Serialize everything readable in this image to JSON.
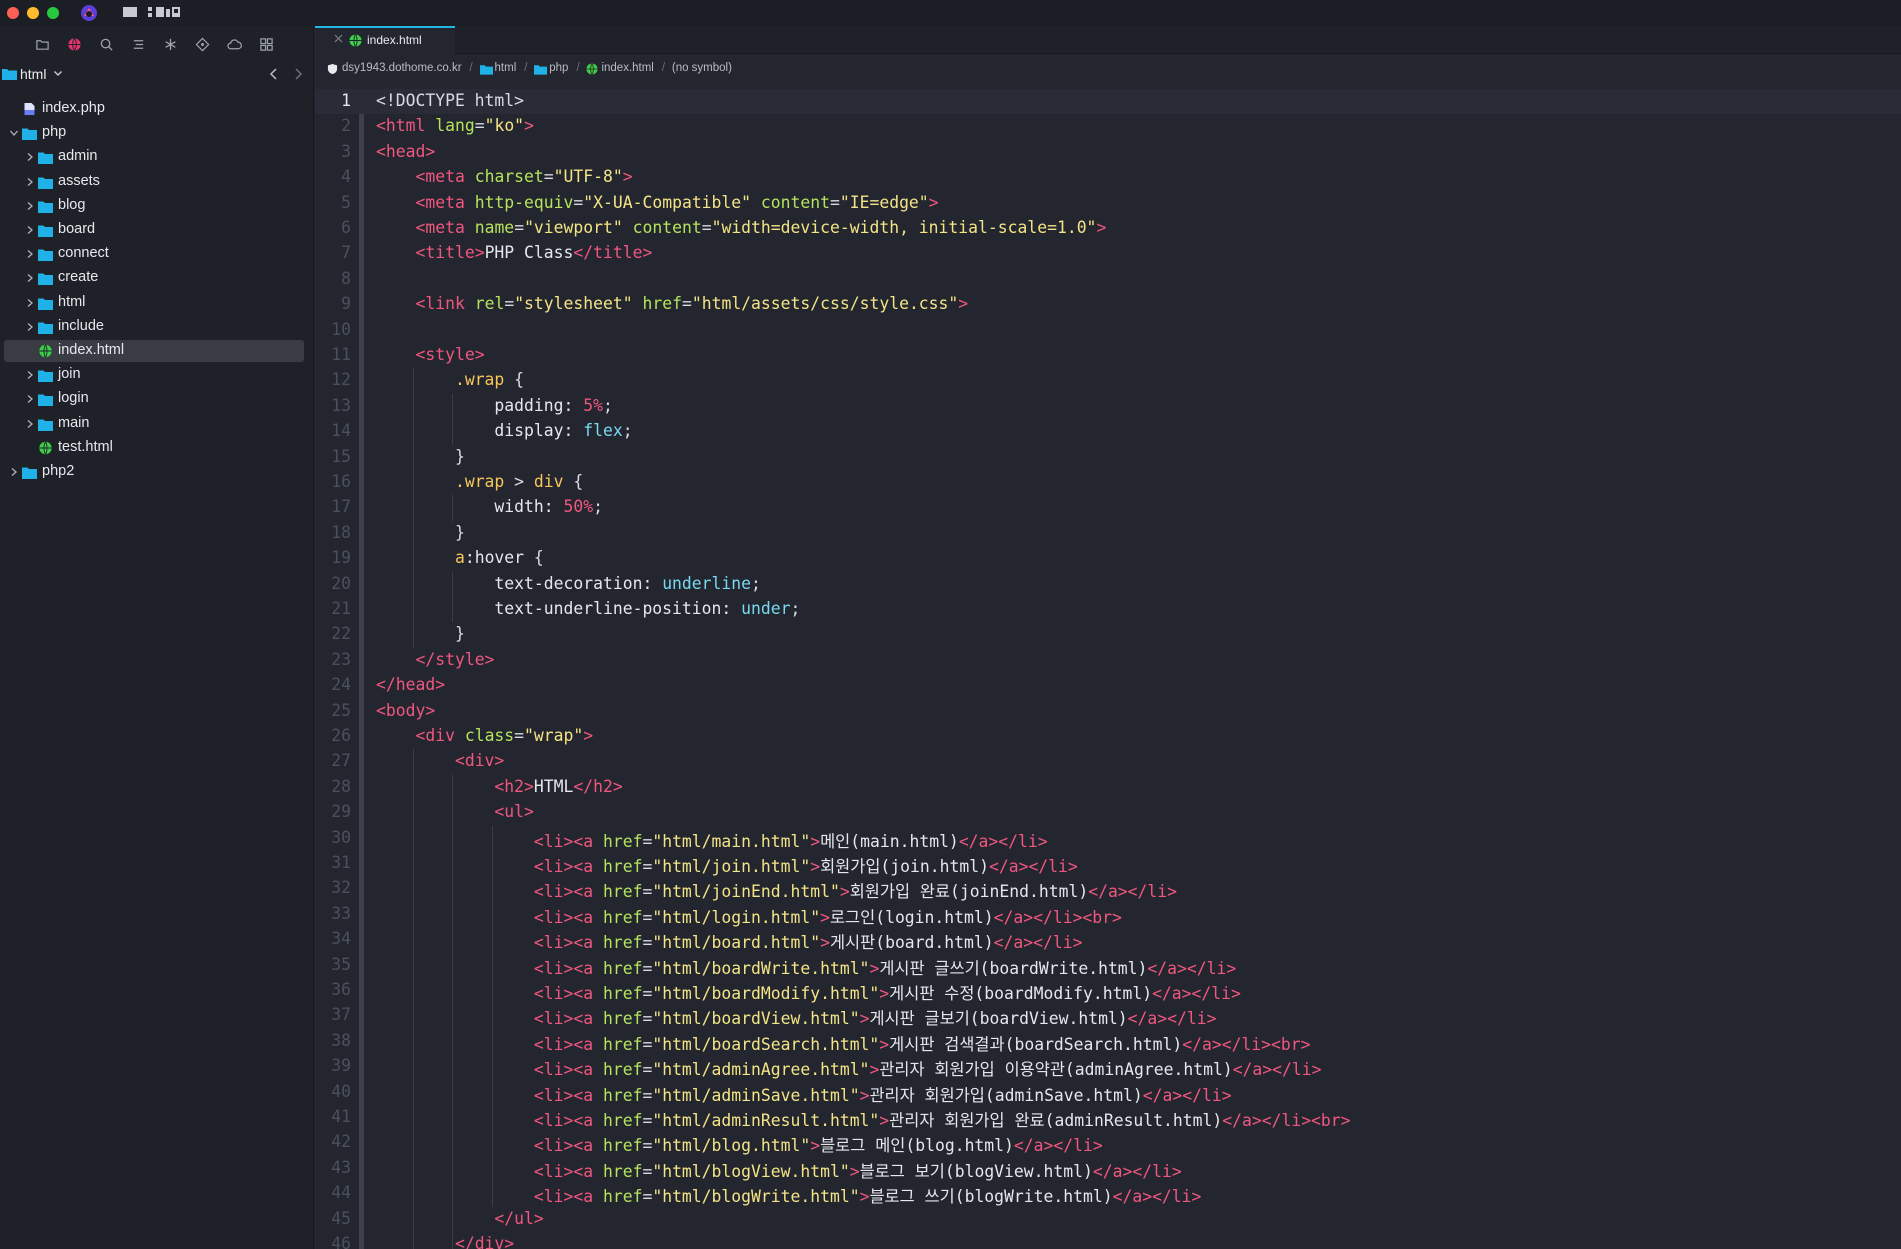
{
  "window": {
    "title_hidden": true
  },
  "colors": {
    "accent": "#21b6e4",
    "folder": "#1fb1e8",
    "html_file": "#3ecf4a",
    "php_file": "#6b7cf5",
    "tag": "#f0577e",
    "attr": "#b5e35d",
    "string": "#f3e486"
  },
  "sidebar": {
    "toolbar_icons": [
      "folder-icon",
      "globe-icon",
      "search-icon",
      "symbols-icon",
      "asterisk-icon",
      "git-icon",
      "cloud-icon",
      "grid-icon"
    ],
    "scope_label": "html",
    "tree": [
      {
        "label": "index.php",
        "type": "php",
        "depth": 0,
        "chevron": "none"
      },
      {
        "label": "php",
        "type": "folder",
        "depth": 0,
        "chevron": "open"
      },
      {
        "label": "admin",
        "type": "folder",
        "depth": 1,
        "chevron": "closed"
      },
      {
        "label": "assets",
        "type": "folder",
        "depth": 1,
        "chevron": "closed"
      },
      {
        "label": "blog",
        "type": "folder",
        "depth": 1,
        "chevron": "closed"
      },
      {
        "label": "board",
        "type": "folder",
        "depth": 1,
        "chevron": "closed"
      },
      {
        "label": "connect",
        "type": "folder",
        "depth": 1,
        "chevron": "closed"
      },
      {
        "label": "create",
        "type": "folder",
        "depth": 1,
        "chevron": "closed"
      },
      {
        "label": "html",
        "type": "folder",
        "depth": 1,
        "chevron": "closed"
      },
      {
        "label": "include",
        "type": "folder",
        "depth": 1,
        "chevron": "closed"
      },
      {
        "label": "index.html",
        "type": "html",
        "depth": 1,
        "chevron": "none",
        "selected": true
      },
      {
        "label": "join",
        "type": "folder",
        "depth": 1,
        "chevron": "closed"
      },
      {
        "label": "login",
        "type": "folder",
        "depth": 1,
        "chevron": "closed"
      },
      {
        "label": "main",
        "type": "folder",
        "depth": 1,
        "chevron": "closed"
      },
      {
        "label": "test.html",
        "type": "html",
        "depth": 1,
        "chevron": "none"
      },
      {
        "label": "php2",
        "type": "folder",
        "depth": 0,
        "chevron": "closed"
      }
    ]
  },
  "editor": {
    "tab": {
      "label": "index.html"
    },
    "breadcrumb": [
      {
        "label": "dsy1943.dothome.co.kr",
        "icon": "shield"
      },
      {
        "label": "html",
        "icon": "folder"
      },
      {
        "label": "php",
        "icon": "folder"
      },
      {
        "label": "index.html",
        "icon": "html"
      },
      {
        "label": "(no symbol)",
        "icon": "none"
      }
    ],
    "current_line": 1,
    "lines": [
      [
        [
          "t-punct",
          "<!DOCTYPE html>"
        ]
      ],
      [
        [
          "t-tag",
          "<html "
        ],
        [
          "t-attr",
          "lang"
        ],
        [
          "t-punct",
          "="
        ],
        [
          "t-str",
          "\"ko\""
        ],
        [
          "t-tag",
          ">"
        ]
      ],
      [
        [
          "t-tag",
          "<head>"
        ]
      ],
      [
        [
          "t-punct",
          "    "
        ],
        [
          "t-tag",
          "<meta "
        ],
        [
          "t-attr",
          "charset"
        ],
        [
          "t-punct",
          "="
        ],
        [
          "t-str",
          "\"UTF-8\""
        ],
        [
          "t-tag",
          ">"
        ]
      ],
      [
        [
          "t-punct",
          "    "
        ],
        [
          "t-tag",
          "<meta "
        ],
        [
          "t-attr",
          "http-equiv"
        ],
        [
          "t-punct",
          "="
        ],
        [
          "t-str",
          "\"X-UA-Compatible\""
        ],
        [
          "t-punct",
          " "
        ],
        [
          "t-attr",
          "content"
        ],
        [
          "t-punct",
          "="
        ],
        [
          "t-str",
          "\"IE=edge\""
        ],
        [
          "t-tag",
          ">"
        ]
      ],
      [
        [
          "t-punct",
          "    "
        ],
        [
          "t-tag",
          "<meta "
        ],
        [
          "t-attr",
          "name"
        ],
        [
          "t-punct",
          "="
        ],
        [
          "t-str",
          "\"viewport\""
        ],
        [
          "t-punct",
          " "
        ],
        [
          "t-attr",
          "content"
        ],
        [
          "t-punct",
          "="
        ],
        [
          "t-str",
          "\"width=device-width, initial-scale=1.0\""
        ],
        [
          "t-tag",
          ">"
        ]
      ],
      [
        [
          "t-punct",
          "    "
        ],
        [
          "t-tag",
          "<title>"
        ],
        [
          "t-txt",
          "PHP Class"
        ],
        [
          "t-tag",
          "</title>"
        ]
      ],
      [],
      [
        [
          "t-punct",
          "    "
        ],
        [
          "t-tag",
          "<link "
        ],
        [
          "t-attr",
          "rel"
        ],
        [
          "t-punct",
          "="
        ],
        [
          "t-str",
          "\"stylesheet\""
        ],
        [
          "t-punct",
          " "
        ],
        [
          "t-attr",
          "href"
        ],
        [
          "t-punct",
          "="
        ],
        [
          "t-str",
          "\"html/assets/css/style.css\""
        ],
        [
          "t-tag",
          ">"
        ]
      ],
      [],
      [
        [
          "t-punct",
          "    "
        ],
        [
          "t-tag",
          "<style>"
        ]
      ],
      [
        [
          "t-punct",
          "        "
        ],
        [
          "t-sel",
          ".wrap"
        ],
        [
          "t-punct",
          " {"
        ]
      ],
      [
        [
          "t-punct",
          "            "
        ],
        [
          "t-prop",
          "padding: "
        ],
        [
          "t-num",
          "5%"
        ],
        [
          "t-punct",
          ";"
        ]
      ],
      [
        [
          "t-punct",
          "            "
        ],
        [
          "t-prop",
          "display: "
        ],
        [
          "t-kw",
          "flex"
        ],
        [
          "t-punct",
          ";"
        ]
      ],
      [
        [
          "t-punct",
          "        }"
        ]
      ],
      [
        [
          "t-punct",
          "        "
        ],
        [
          "t-sel",
          ".wrap"
        ],
        [
          "t-punct",
          " > "
        ],
        [
          "t-sel",
          "div"
        ],
        [
          "t-punct",
          " {"
        ]
      ],
      [
        [
          "t-punct",
          "            "
        ],
        [
          "t-prop",
          "width: "
        ],
        [
          "t-num",
          "50%"
        ],
        [
          "t-punct",
          ";"
        ]
      ],
      [
        [
          "t-punct",
          "        }"
        ]
      ],
      [
        [
          "t-punct",
          "        "
        ],
        [
          "t-sel",
          "a"
        ],
        [
          "t-prop",
          ":hover"
        ],
        [
          "t-punct",
          " {"
        ]
      ],
      [
        [
          "t-punct",
          "            "
        ],
        [
          "t-prop",
          "text-decoration: "
        ],
        [
          "t-kw",
          "underline"
        ],
        [
          "t-punct",
          ";"
        ]
      ],
      [
        [
          "t-punct",
          "            "
        ],
        [
          "t-prop",
          "text-underline-position: "
        ],
        [
          "t-kw",
          "under"
        ],
        [
          "t-punct",
          ";"
        ]
      ],
      [
        [
          "t-punct",
          "        }"
        ]
      ],
      [
        [
          "t-punct",
          "    "
        ],
        [
          "t-tag",
          "</style>"
        ]
      ],
      [
        [
          "t-tag",
          "</head>"
        ]
      ],
      [
        [
          "t-tag",
          "<body>"
        ]
      ],
      [
        [
          "t-punct",
          "    "
        ],
        [
          "t-tag",
          "<div "
        ],
        [
          "t-attr",
          "class"
        ],
        [
          "t-punct",
          "="
        ],
        [
          "t-str",
          "\"wrap\""
        ],
        [
          "t-tag",
          ">"
        ]
      ],
      [
        [
          "t-punct",
          "        "
        ],
        [
          "t-tag",
          "<div>"
        ]
      ],
      [
        [
          "t-punct",
          "            "
        ],
        [
          "t-tag",
          "<h2>"
        ],
        [
          "t-txt",
          "HTML"
        ],
        [
          "t-tag",
          "</h2>"
        ]
      ],
      [
        [
          "t-punct",
          "            "
        ],
        [
          "t-tag",
          "<ul>"
        ]
      ],
      [
        [
          "t-punct",
          "                "
        ],
        [
          "t-tag",
          "<li><a "
        ],
        [
          "t-attr",
          "href"
        ],
        [
          "t-punct",
          "="
        ],
        [
          "t-str",
          "\"html/main.html\""
        ],
        [
          "t-tag",
          ">"
        ],
        [
          "t-txt",
          "메인(main.html)"
        ],
        [
          "t-tag",
          "</a></li>"
        ]
      ],
      [
        [
          "t-punct",
          "                "
        ],
        [
          "t-tag",
          "<li><a "
        ],
        [
          "t-attr",
          "href"
        ],
        [
          "t-punct",
          "="
        ],
        [
          "t-str",
          "\"html/join.html\""
        ],
        [
          "t-tag",
          ">"
        ],
        [
          "t-txt",
          "회원가입(join.html)"
        ],
        [
          "t-tag",
          "</a></li>"
        ]
      ],
      [
        [
          "t-punct",
          "                "
        ],
        [
          "t-tag",
          "<li><a "
        ],
        [
          "t-attr",
          "href"
        ],
        [
          "t-punct",
          "="
        ],
        [
          "t-str",
          "\"html/joinEnd.html\""
        ],
        [
          "t-tag",
          ">"
        ],
        [
          "t-txt",
          "회원가입 완료(joinEnd.html)"
        ],
        [
          "t-tag",
          "</a></li>"
        ]
      ],
      [
        [
          "t-punct",
          "                "
        ],
        [
          "t-tag",
          "<li><a "
        ],
        [
          "t-attr",
          "href"
        ],
        [
          "t-punct",
          "="
        ],
        [
          "t-str",
          "\"html/login.html\""
        ],
        [
          "t-tag",
          ">"
        ],
        [
          "t-txt",
          "로그인(login.html)"
        ],
        [
          "t-tag",
          "</a></li><br>"
        ]
      ],
      [
        [
          "t-punct",
          "                "
        ],
        [
          "t-tag",
          "<li><a "
        ],
        [
          "t-attr",
          "href"
        ],
        [
          "t-punct",
          "="
        ],
        [
          "t-str",
          "\"html/board.html\""
        ],
        [
          "t-tag",
          ">"
        ],
        [
          "t-txt",
          "게시판(board.html)"
        ],
        [
          "t-tag",
          "</a></li>"
        ]
      ],
      [
        [
          "t-punct",
          "                "
        ],
        [
          "t-tag",
          "<li><a "
        ],
        [
          "t-attr",
          "href"
        ],
        [
          "t-punct",
          "="
        ],
        [
          "t-str",
          "\"html/boardWrite.html\""
        ],
        [
          "t-tag",
          ">"
        ],
        [
          "t-txt",
          "게시판 글쓰기(boardWrite.html)"
        ],
        [
          "t-tag",
          "</a></li>"
        ]
      ],
      [
        [
          "t-punct",
          "                "
        ],
        [
          "t-tag",
          "<li><a "
        ],
        [
          "t-attr",
          "href"
        ],
        [
          "t-punct",
          "="
        ],
        [
          "t-str",
          "\"html/boardModify.html\""
        ],
        [
          "t-tag",
          ">"
        ],
        [
          "t-txt",
          "게시판 수정(boardModify.html)"
        ],
        [
          "t-tag",
          "</a></li>"
        ]
      ],
      [
        [
          "t-punct",
          "                "
        ],
        [
          "t-tag",
          "<li><a "
        ],
        [
          "t-attr",
          "href"
        ],
        [
          "t-punct",
          "="
        ],
        [
          "t-str",
          "\"html/boardView.html\""
        ],
        [
          "t-tag",
          ">"
        ],
        [
          "t-txt",
          "게시판 글보기(boardView.html)"
        ],
        [
          "t-tag",
          "</a></li>"
        ]
      ],
      [
        [
          "t-punct",
          "                "
        ],
        [
          "t-tag",
          "<li><a "
        ],
        [
          "t-attr",
          "href"
        ],
        [
          "t-punct",
          "="
        ],
        [
          "t-str",
          "\"html/boardSearch.html\""
        ],
        [
          "t-tag",
          ">"
        ],
        [
          "t-txt",
          "게시판 검색결과(boardSearch.html)"
        ],
        [
          "t-tag",
          "</a></li><br>"
        ]
      ],
      [
        [
          "t-punct",
          "                "
        ],
        [
          "t-tag",
          "<li><a "
        ],
        [
          "t-attr",
          "href"
        ],
        [
          "t-punct",
          "="
        ],
        [
          "t-str",
          "\"html/adminAgree.html\""
        ],
        [
          "t-tag",
          ">"
        ],
        [
          "t-txt",
          "관리자 회원가입 이용약관(adminAgree.html)"
        ],
        [
          "t-tag",
          "</a></li>"
        ]
      ],
      [
        [
          "t-punct",
          "                "
        ],
        [
          "t-tag",
          "<li><a "
        ],
        [
          "t-attr",
          "href"
        ],
        [
          "t-punct",
          "="
        ],
        [
          "t-str",
          "\"html/adminSave.html\""
        ],
        [
          "t-tag",
          ">"
        ],
        [
          "t-txt",
          "관리자 회원가입(adminSave.html)"
        ],
        [
          "t-tag",
          "</a></li>"
        ]
      ],
      [
        [
          "t-punct",
          "                "
        ],
        [
          "t-tag",
          "<li><a "
        ],
        [
          "t-attr",
          "href"
        ],
        [
          "t-punct",
          "="
        ],
        [
          "t-str",
          "\"html/adminResult.html\""
        ],
        [
          "t-tag",
          ">"
        ],
        [
          "t-txt",
          "관리자 회원가입 완료(adminResult.html)"
        ],
        [
          "t-tag",
          "</a></li><br>"
        ]
      ],
      [
        [
          "t-punct",
          "                "
        ],
        [
          "t-tag",
          "<li><a "
        ],
        [
          "t-attr",
          "href"
        ],
        [
          "t-punct",
          "="
        ],
        [
          "t-str",
          "\"html/blog.html\""
        ],
        [
          "t-tag",
          ">"
        ],
        [
          "t-txt",
          "블로그 메인(blog.html)"
        ],
        [
          "t-tag",
          "</a></li>"
        ]
      ],
      [
        [
          "t-punct",
          "                "
        ],
        [
          "t-tag",
          "<li><a "
        ],
        [
          "t-attr",
          "href"
        ],
        [
          "t-punct",
          "="
        ],
        [
          "t-str",
          "\"html/blogView.html\""
        ],
        [
          "t-tag",
          ">"
        ],
        [
          "t-txt",
          "블로그 보기(blogView.html)"
        ],
        [
          "t-tag",
          "</a></li>"
        ]
      ],
      [
        [
          "t-punct",
          "                "
        ],
        [
          "t-tag",
          "<li><a "
        ],
        [
          "t-attr",
          "href"
        ],
        [
          "t-punct",
          "="
        ],
        [
          "t-str",
          "\"html/blogWrite.html\""
        ],
        [
          "t-tag",
          ">"
        ],
        [
          "t-txt",
          "블로그 쓰기(blogWrite.html)"
        ],
        [
          "t-tag",
          "</a></li>"
        ]
      ],
      [
        [
          "t-punct",
          "            "
        ],
        [
          "t-tag",
          "</ul>"
        ]
      ],
      [
        [
          "t-punct",
          "        "
        ],
        [
          "t-tag",
          "</div>"
        ]
      ]
    ]
  }
}
